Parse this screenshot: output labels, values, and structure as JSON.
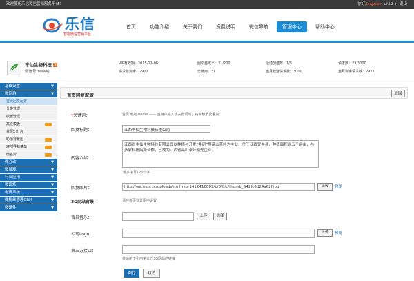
{
  "topbar": {
    "welcome": "欢迎使用乐信微信营销服务平台!",
    "greeting": "你好,",
    "username": "lingxian",
    "uid": "( uid:2 )",
    "logout": "退出"
  },
  "logo": {
    "text": "乐信",
    "subtitle": "智能微信营销平台"
  },
  "nav": [
    "首页",
    "功能介绍",
    "关于我们",
    "资费说明",
    "微信导航",
    "管理中心",
    "帮助中心"
  ],
  "nav_active": 5,
  "account": {
    "name": "丰仙生物科技",
    "wxid": "微信号:fxswkj",
    "vip": "VIP有效期：2015-11-08",
    "req_remain": "请求数剩余：2977",
    "img_custom": "图文自定义：31/200",
    "used": "已使用：31",
    "activity": "活动创建数：1/5",
    "monthly_gift": "当月赠送请求数：3000",
    "requests": "请求数：23/3000",
    "monthly_remain": "当月剩余请求数：2977"
  },
  "sidebar": [
    {
      "type": "group",
      "label": "基础设置"
    },
    {
      "type": "group",
      "label": "微网站"
    },
    {
      "type": "sub",
      "label": "首页回复配置",
      "active": true
    },
    {
      "type": "sub",
      "label": "分类管理"
    },
    {
      "type": "sub",
      "label": "模板管理"
    },
    {
      "type": "sub",
      "label": "高级模板",
      "new": true
    },
    {
      "type": "sub",
      "label": "首页幻灯片"
    },
    {
      "type": "sub",
      "label": "轮播背景图",
      "new": true
    },
    {
      "type": "sub",
      "label": "底部导航菜单",
      "new": true
    },
    {
      "type": "sub",
      "label": "微名片",
      "new": true
    },
    {
      "type": "group",
      "label": "微互动"
    },
    {
      "type": "group",
      "label": "微游戏"
    },
    {
      "type": "group",
      "label": "行业应用"
    },
    {
      "type": "group",
      "label": "微现场"
    },
    {
      "type": "group",
      "label": "电商系统"
    },
    {
      "type": "group",
      "label": "微粉丝管理CRM"
    },
    {
      "type": "group",
      "label": "微硬件"
    }
  ],
  "main": {
    "title": "首页回复配置",
    "back": "返回",
    "keyword_label": "关键词：",
    "keyword_star": "*",
    "keyword_hint": "首页 或者 home —— 当用户输入该关键词时，将会触发此回复。",
    "reply_title_label": "回复标题：",
    "reply_title_value": "江西丰仙生物科技有限公司",
    "intro_label": "内容介绍：",
    "intro_value": "江西省丰仙生物科技有限公司以种植与开发“鲁研”等高山茶叶为主业，位于江西宜丰县，种植面积逾五千余亩，与多家科研院所合作，已成为江西省高山茶叶领先企业。",
    "intro_hint": "最多填写120个字",
    "image_label": "回复图片：",
    "image_value": "http://wx.mus.cc/uploads/n/nhrspr1412416889/b/6/0/c/thumb_542fc6d24a62f.jpg",
    "upload": "上传",
    "preview": "预览",
    "bg3g_label": "3G网站背景：",
    "bg3g_hint": "请在首页背景图中设置",
    "music_label": "背景音乐：",
    "select": "选择",
    "logo_label": "公司Logo：",
    "third_label": "第三方接口：",
    "third_hint": "只适用于引用第三方3G网站的链接",
    "save": "保存",
    "cancel": "取消"
  }
}
